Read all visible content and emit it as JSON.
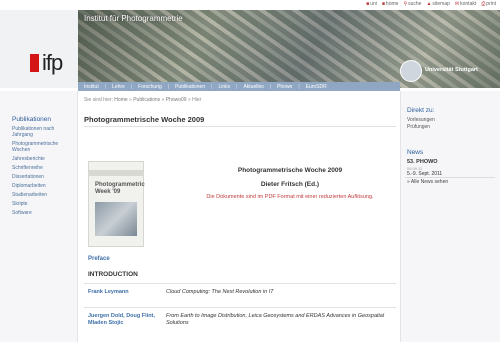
{
  "utility": [
    {
      "icon": "home-icon",
      "label": "uni"
    },
    {
      "icon": "home-icon",
      "label": "home"
    },
    {
      "icon": "search-icon",
      "label": "suche"
    },
    {
      "icon": "sitemap-icon",
      "label": "sitemap"
    },
    {
      "icon": "mail-icon",
      "label": "kontakt"
    },
    {
      "icon": "print-icon",
      "label": "print"
    }
  ],
  "header": {
    "title": "Institut für Photogrammetrie",
    "logo_text": "ifp",
    "university": "Universität Stuttgart"
  },
  "nav": [
    "Institut",
    "Lehre",
    "Forschung",
    "Publikationen",
    "Links",
    "Aktuelles",
    "Phowo",
    "EuroSDR"
  ],
  "breadcrumb": {
    "prefix": "Sie sind hier:",
    "items": [
      "Home",
      "Publications",
      "Phowo09",
      "Hier"
    ]
  },
  "sidebar": {
    "heading": "Publikationen",
    "items": [
      "Publikationen nach Jahrgang",
      "Photogrammetrische Wochen",
      "Jahresberichte",
      "Schriftenreihe",
      "Dissertationen",
      "Diplomarbeiten",
      "Studienarbeiten",
      "Skripte",
      "Software"
    ]
  },
  "main": {
    "title": "Photogrammetrische Woche 2009",
    "book_title": "Photogrammetric Week '09",
    "info_title": "Photogrammetrische Woche 2009",
    "editor": "Dieter Fritsch (Ed.)",
    "note": "Die Dokumente sind im PDF Format mit einer reduzierten Auflösung.",
    "preface": "Preface",
    "section": "INTRODUCTION",
    "papers": [
      {
        "author": "Frank Leymann",
        "title": "Cloud Computing: The Next Revolution in IT"
      },
      {
        "author": "Juergen Dold, Doug Flint, Mladen Stojic",
        "title": "From Earth to Image Distribution, Leica Geosystems and ERDAS Advances in Geospatial Solutions"
      }
    ]
  },
  "right": {
    "direct_heading": "Direkt zu:",
    "direct_items": [
      "Vorlesungen",
      "Prüfungen"
    ],
    "news_heading": "News",
    "event": "53. PHOWO",
    "event_small": "09.09.11",
    "event_date": "5.-9. Sept. 2011",
    "all_news": "Alle News sehen"
  }
}
